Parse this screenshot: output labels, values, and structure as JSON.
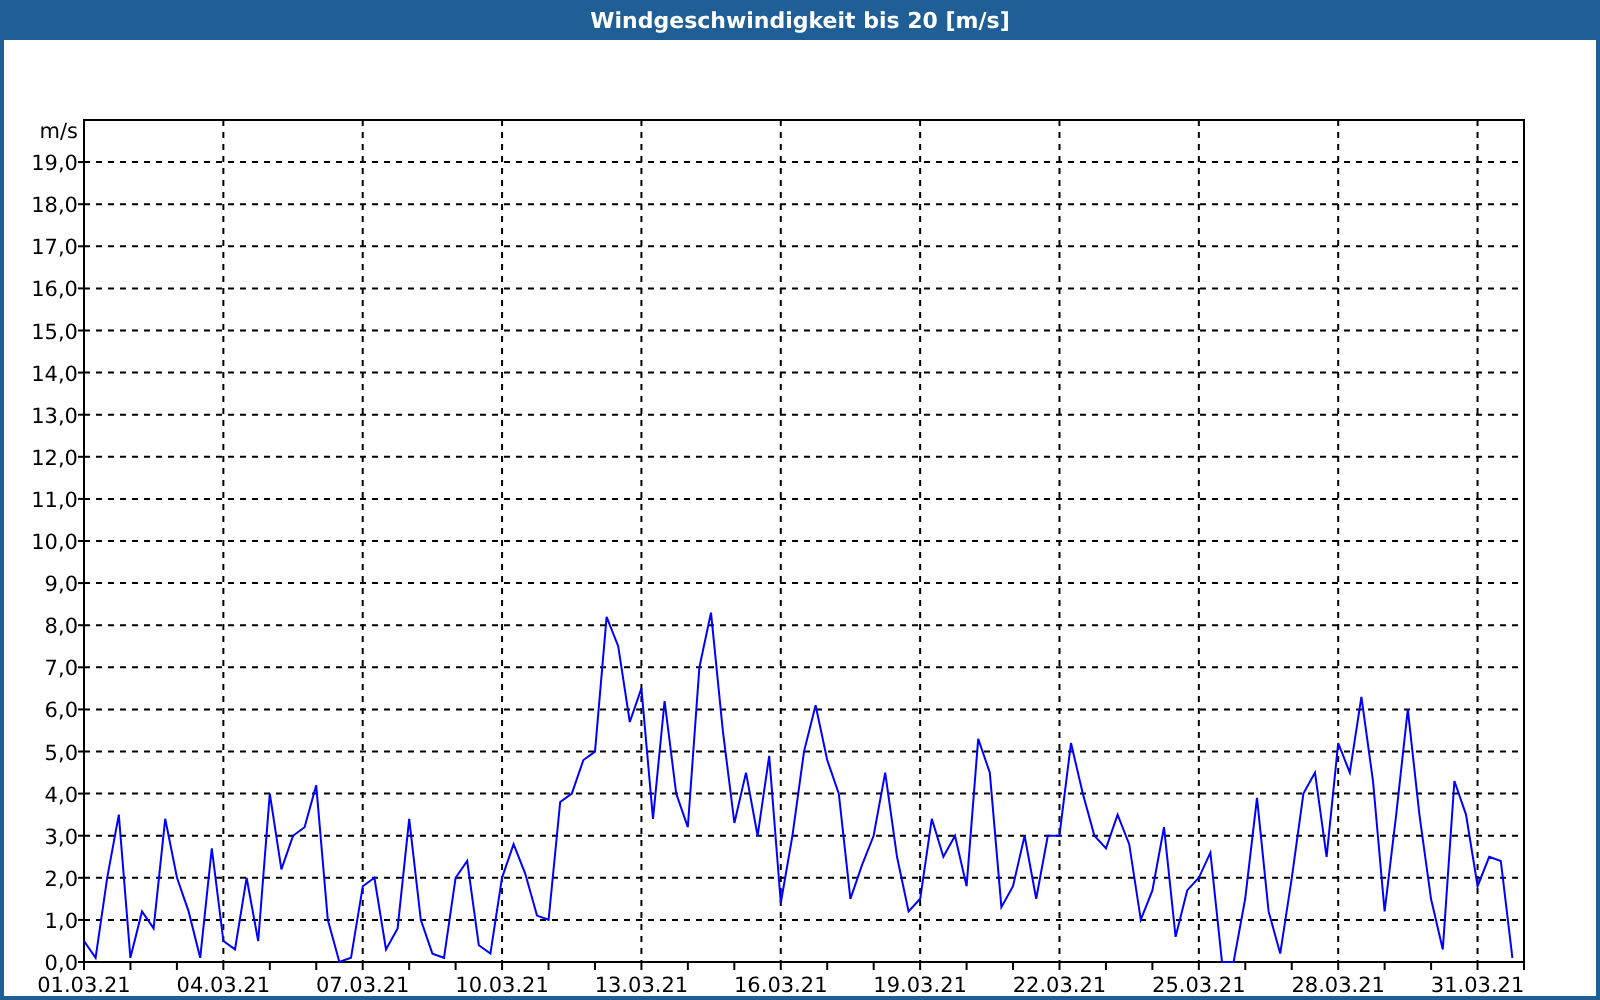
{
  "window": {
    "title": "Windgeschwindigkeit bis 20 [m/s]"
  },
  "chart": {
    "chart_data": {
      "type": "line",
      "grid": true,
      "ylabel": "m/s",
      "ylim": [
        0,
        20
      ],
      "yticks": [
        {
          "value": 0,
          "label": "0,0"
        },
        {
          "value": 1,
          "label": "1,0"
        },
        {
          "value": 2,
          "label": "2,0"
        },
        {
          "value": 3,
          "label": "3,0"
        },
        {
          "value": 4,
          "label": "4,0"
        },
        {
          "value": 5,
          "label": "5,0"
        },
        {
          "value": 6,
          "label": "6,0"
        },
        {
          "value": 7,
          "label": "7,0"
        },
        {
          "value": 8,
          "label": "8,0"
        },
        {
          "value": 9,
          "label": "9,0"
        },
        {
          "value": 10,
          "label": "10,0"
        },
        {
          "value": 11,
          "label": "11,0"
        },
        {
          "value": 12,
          "label": "12,0"
        },
        {
          "value": 13,
          "label": "13,0"
        },
        {
          "value": 14,
          "label": "14,0"
        },
        {
          "value": 15,
          "label": "15,0"
        },
        {
          "value": 16,
          "label": "16,0"
        },
        {
          "value": 17,
          "label": "17,0"
        },
        {
          "value": 18,
          "label": "18,0"
        },
        {
          "value": 19,
          "label": "19,0"
        }
      ],
      "categories": [
        "01.03.21",
        null,
        null,
        null,
        null,
        null,
        null,
        null,
        null,
        null,
        null,
        null,
        "04.03.21",
        null,
        null,
        null,
        null,
        null,
        null,
        null,
        null,
        null,
        null,
        null,
        "07.03.21",
        null,
        null,
        null,
        null,
        null,
        null,
        null,
        null,
        null,
        null,
        null,
        "10.03.21",
        null,
        null,
        null,
        null,
        null,
        null,
        null,
        null,
        null,
        null,
        null,
        "13.03.21",
        null,
        null,
        null,
        null,
        null,
        null,
        null,
        null,
        null,
        null,
        null,
        "16.03.21",
        null,
        null,
        null,
        null,
        null,
        null,
        null,
        null,
        null,
        null,
        null,
        "19.03.21",
        null,
        null,
        null,
        null,
        null,
        null,
        null,
        null,
        null,
        null,
        null,
        "22.03.21",
        null,
        null,
        null,
        null,
        null,
        null,
        null,
        null,
        null,
        null,
        null,
        "25.03.21",
        null,
        null,
        null,
        null,
        null,
        null,
        null,
        null,
        null,
        null,
        null,
        "28.03.21",
        null,
        null,
        null,
        null,
        null,
        null,
        null,
        null,
        null,
        null,
        null,
        "31.03.21",
        null,
        null,
        null
      ],
      "series": [
        {
          "color": "#0000ff",
          "values": [
            0.5,
            0.1,
            2.0,
            3.5,
            0.1,
            1.2,
            0.8,
            3.4,
            2.0,
            1.2,
            0.1,
            2.7,
            0.5,
            0.3,
            2.0,
            0.5,
            4.0,
            2.2,
            3.0,
            3.2,
            4.2,
            1.0,
            0,
            0.1,
            1.8,
            2.0,
            0.3,
            0.8,
            3.4,
            1.0,
            0.2,
            0.1,
            2.0,
            2.4,
            0.4,
            0.2,
            2.0,
            2.8,
            2.1,
            1.1,
            1.0,
            3.8,
            4.0,
            4.8,
            5.0,
            8.2,
            7.5,
            5.7,
            6.5,
            3.4,
            6.2,
            4.0,
            3.2,
            7.0,
            8.3,
            5.5,
            3.3,
            4.5,
            3.0,
            4.9,
            1.4,
            3.0,
            5.0,
            6.1,
            4.8,
            4.0,
            1.5,
            2.3,
            3.0,
            4.5,
            2.5,
            1.2,
            1.5,
            3.4,
            2.5,
            3.0,
            1.8,
            5.3,
            4.5,
            1.3,
            1.8,
            3.0,
            1.5,
            3.0,
            3.0,
            5.2,
            4.0,
            3.0,
            2.7,
            3.5,
            2.8,
            1.0,
            1.7,
            3.2,
            0.6,
            1.7,
            2.0,
            2.6,
            0,
            0,
            1.5,
            3.9,
            1.2,
            0.2,
            2.0,
            4.0,
            4.5,
            2.5,
            5.2,
            4.5,
            6.3,
            4.3,
            1.2,
            3.5,
            6.0,
            3.5,
            1.5,
            0.3,
            4.3,
            3.5,
            1.8,
            2.5,
            2.4,
            0.1
          ]
        }
      ]
    }
  }
}
